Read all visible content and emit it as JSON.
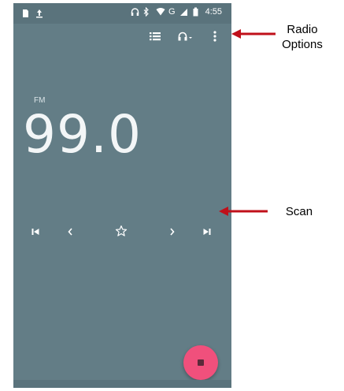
{
  "status_bar": {
    "time": "4:55",
    "signal_label": "G",
    "icons": [
      "sim-icon",
      "upload-icon",
      "headset-icon",
      "bluetooth-icon",
      "wifi-icon",
      "cell-signal-icon",
      "battery-icon"
    ]
  },
  "toolbar": {
    "icons": [
      "station-list-icon",
      "headset-icon",
      "more-options-icon"
    ]
  },
  "radio": {
    "band": "FM",
    "frequency": "99.0"
  },
  "controls": {
    "icons": [
      "skip-previous-icon",
      "chevron-left-icon",
      "star-icon",
      "chevron-right-icon",
      "skip-next-icon"
    ]
  },
  "fab": {
    "icon": "stop-icon",
    "color": "#f0507c"
  },
  "annotations": {
    "radio_options": [
      "Radio",
      "Options"
    ],
    "scan": "Scan"
  },
  "colors": {
    "background": "#637d86",
    "status_bar": "#5a737c",
    "arrow": "#c0101a"
  }
}
